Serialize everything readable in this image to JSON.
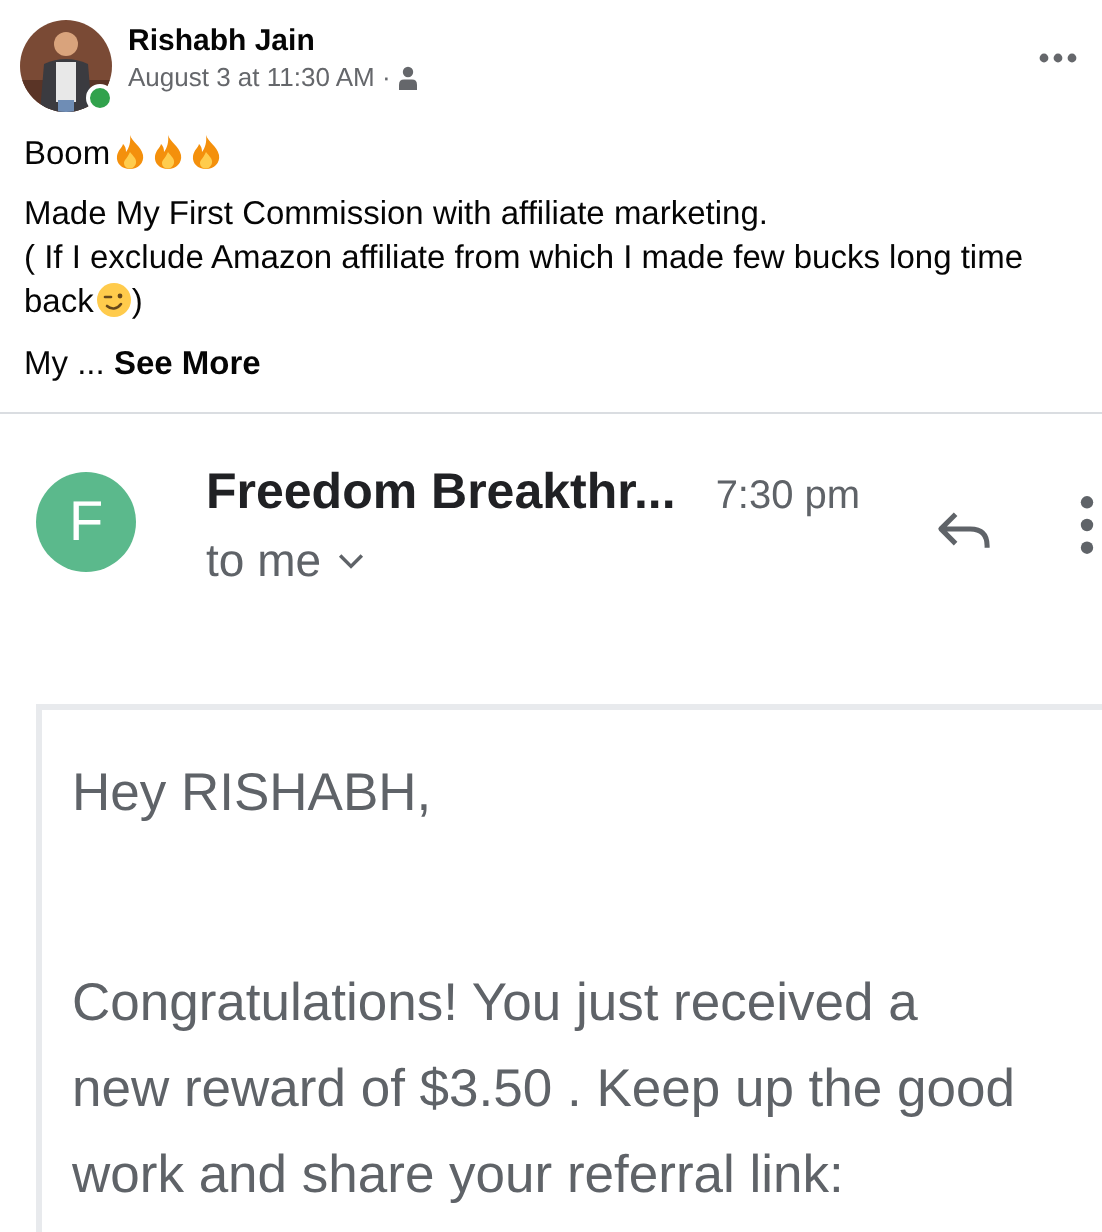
{
  "post": {
    "author": "Rishabh Jain",
    "online": true,
    "timestamp": "August 3 at 11:30 AM ·",
    "headline": "Boom",
    "headline_emojis": [
      {
        "kind": "fire"
      },
      {
        "kind": "fire"
      },
      {
        "kind": "fire"
      }
    ],
    "body_lines": [
      "Made My First Commission with affiliate marketing.",
      "( If I exclude Amazon affiliate from which I made few bucks long time",
      "back"
    ],
    "body_emoji": {
      "kind": "wink"
    },
    "body_tail": ")",
    "truncated": "My ...",
    "see_more": "See More"
  },
  "email": {
    "avatar_letter": "F",
    "sender": "Freedom Breakthr...",
    "time": "7:30 pm",
    "recipient": "to me",
    "greeting": "Hey RISHABH,",
    "message": "Congratulations! You just received a new reward of $3.50 . Keep up the good work and share your referral link:"
  }
}
